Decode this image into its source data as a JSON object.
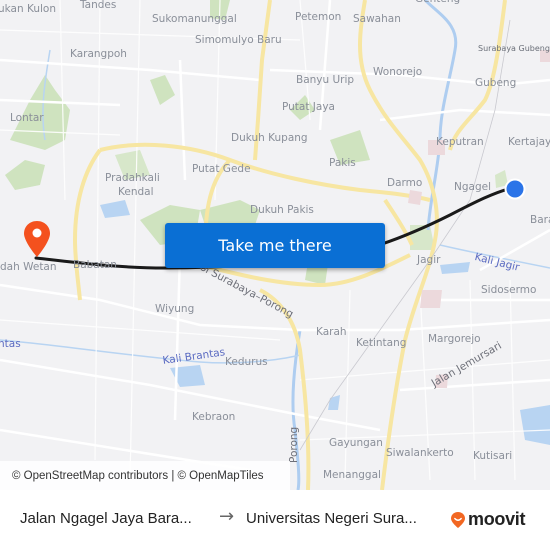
{
  "map": {
    "labels": [
      {
        "text": "ukan Kulon",
        "cls": ""
      },
      {
        "text": "Tandes",
        "cls": ""
      },
      {
        "text": "Sukomanunggal",
        "cls": ""
      },
      {
        "text": "Petemon",
        "cls": ""
      },
      {
        "text": "Sawahan",
        "cls": ""
      },
      {
        "text": "Genteng",
        "cls": ""
      },
      {
        "text": "Simomulyo Baru",
        "cls": ""
      },
      {
        "text": "Surabaya Gubeng",
        "cls": "sm"
      },
      {
        "text": "Karangpoh",
        "cls": ""
      },
      {
        "text": "Wonorejo",
        "cls": ""
      },
      {
        "text": "Banyu Urip",
        "cls": ""
      },
      {
        "text": "Gubeng",
        "cls": ""
      },
      {
        "text": "Putat Jaya",
        "cls": ""
      },
      {
        "text": "Lontar",
        "cls": ""
      },
      {
        "text": "Dukuh Kupang",
        "cls": ""
      },
      {
        "text": "Keputran",
        "cls": ""
      },
      {
        "text": "Kertajaya",
        "cls": ""
      },
      {
        "text": "Pakis",
        "cls": ""
      },
      {
        "text": "Putat Gede",
        "cls": ""
      },
      {
        "text": "Pradahkali",
        "cls": ""
      },
      {
        "text": "Kendal",
        "cls": ""
      },
      {
        "text": "Darmo",
        "cls": ""
      },
      {
        "text": "Ngagel",
        "cls": ""
      },
      {
        "text": "Dukuh Pakis",
        "cls": ""
      },
      {
        "text": "Bara",
        "cls": ""
      },
      {
        "text": "dah Wetan",
        "cls": ""
      },
      {
        "text": "Babatan",
        "cls": ""
      },
      {
        "text": "Jagir",
        "cls": ""
      },
      {
        "text": "Kali Jagir",
        "cls": "water"
      },
      {
        "text": "ol Surabaya–Porong",
        "cls": "road"
      },
      {
        "text": "Sidosermo",
        "cls": ""
      },
      {
        "text": "Wiyung",
        "cls": ""
      },
      {
        "text": "Karah",
        "cls": ""
      },
      {
        "text": "Margorejo",
        "cls": ""
      },
      {
        "text": "ntas",
        "cls": "water"
      },
      {
        "text": "Ketintang",
        "cls": ""
      },
      {
        "text": "Kali Brantas",
        "cls": "water"
      },
      {
        "text": "Kedurus",
        "cls": ""
      },
      {
        "text": "Jalan Jemursari",
        "cls": "road"
      },
      {
        "text": "Kebraon",
        "cls": ""
      },
      {
        "text": "Gayungan",
        "cls": ""
      },
      {
        "text": "Siwalankerto",
        "cls": ""
      },
      {
        "text": "Kutisari",
        "cls": ""
      },
      {
        "text": "Menanggal",
        "cls": ""
      },
      {
        "text": "Porong",
        "cls": "road"
      }
    ],
    "origin_marker": {
      "color": "#2b74e8"
    },
    "destination_marker": {
      "color": "#f4511e"
    },
    "route_color": "#1a1a1a",
    "attribution": "© OpenStreetMap contributors | © OpenMapTiles"
  },
  "cta": {
    "label": "Take me there",
    "color": "#0a6fd4"
  },
  "footer": {
    "from": "Jalan Ngagel Jaya Bara...",
    "arrow": "→",
    "to": "Universitas Negeri Sura...",
    "logo_text": "moovit",
    "logo_color": "#f26722"
  }
}
